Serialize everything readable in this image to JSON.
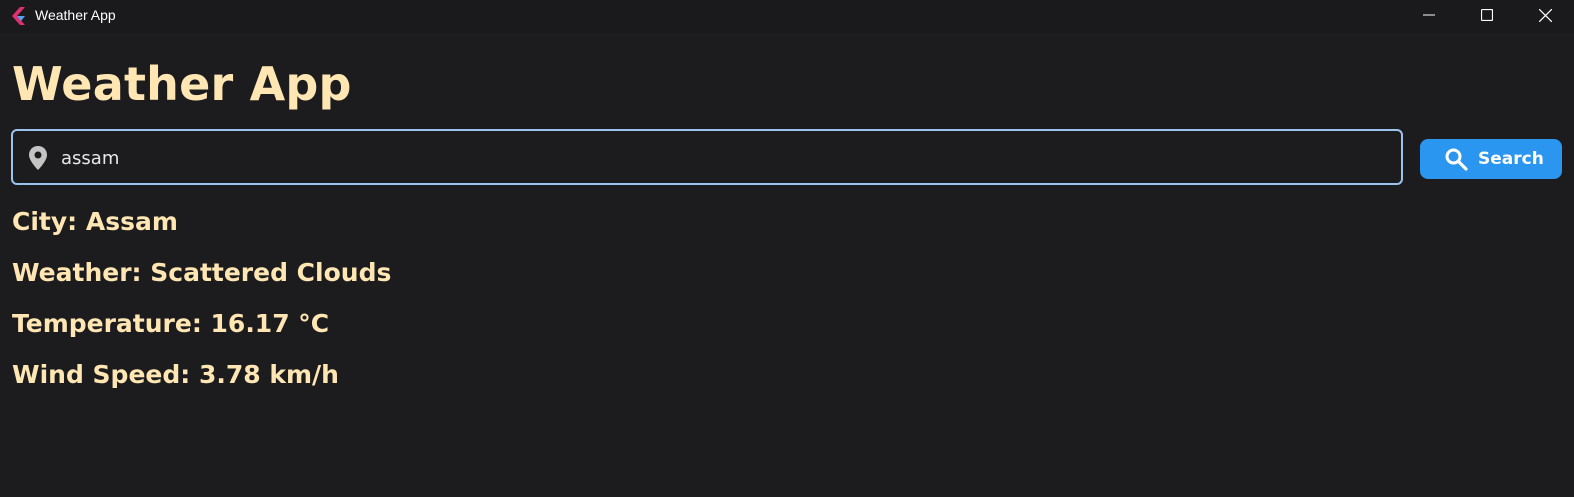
{
  "window": {
    "title": "Weather App"
  },
  "header": {
    "title": "Weather App"
  },
  "search": {
    "value": "assam",
    "button_label": "Search",
    "icon": "search-icon",
    "field_icon": "location-pin-icon"
  },
  "result": {
    "city": "City: Assam",
    "weather": "Weather: Scattered Clouds",
    "temperature": "Temperature: 16.17 °C",
    "wind_speed": "Wind Speed: 3.78 km/h"
  },
  "colors": {
    "background": "#1c1c1f",
    "text_accent": "#ffe6b3",
    "button": "#2b96ef",
    "input_border": "#9cc2ee"
  }
}
